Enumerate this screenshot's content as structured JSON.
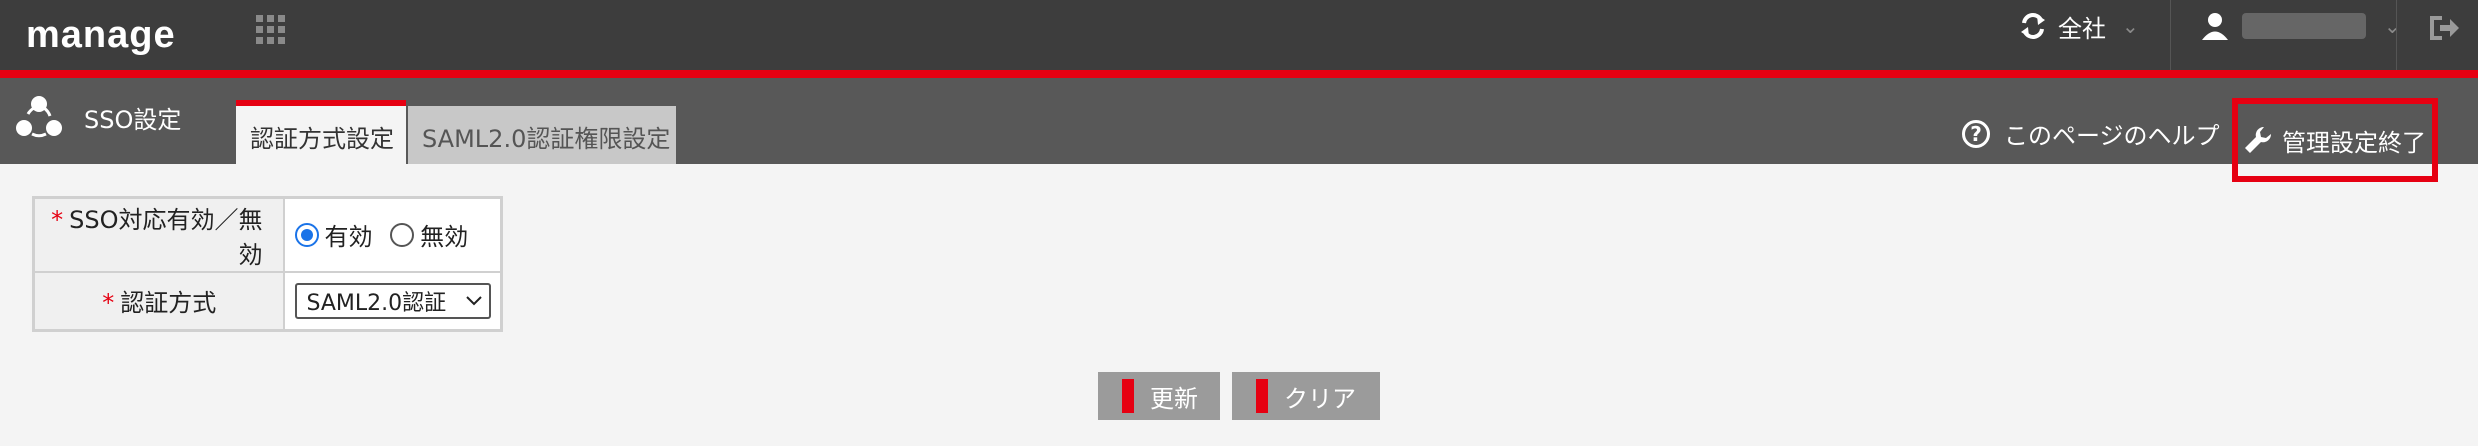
{
  "header": {
    "logo": "manage",
    "company_label": "全社",
    "user_name": ""
  },
  "subheader": {
    "page_title": "SSO設定",
    "tabs": [
      {
        "label": "認証方式設定",
        "active": true
      },
      {
        "label": "SAML2.0認証権限設定",
        "active": false
      }
    ],
    "help_label": "このページのヘルプ",
    "admin_end_label": "管理設定終了"
  },
  "form": {
    "rows": [
      {
        "label": "SSO対応有効／無効",
        "required": true
      },
      {
        "label": "認証方式",
        "required": true
      }
    ],
    "required_mark": "*",
    "radio_options": [
      "有効",
      "無効"
    ],
    "radio_selected": "有効",
    "auth_method_value": "SAML2.0認証"
  },
  "actions": {
    "update_label": "更新",
    "clear_label": "クリア"
  },
  "colors": {
    "accent_red": "#e60012",
    "header_bg": "#3d3d3d",
    "subheader_bg": "#585858",
    "radio_blue": "#1a73e8"
  },
  "icons": [
    "apps-grid-icon",
    "sync-icon",
    "user-icon",
    "logout-icon",
    "sso-share-icon",
    "help-icon",
    "wrench-icon",
    "chevron-down-icon"
  ]
}
